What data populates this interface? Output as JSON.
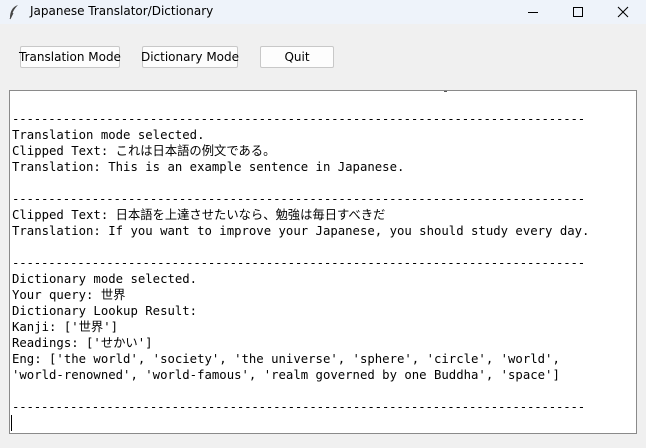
{
  "window": {
    "title": "Japanese Translator/Dictionary",
    "controls": [
      "minimize",
      "maximize",
      "close"
    ]
  },
  "toolbar": {
    "translation_label": "Translation Mode",
    "dictionary_label": "Dictionary Mode",
    "quit_label": "Quit"
  },
  "output": {
    "lines": [
      "-------------------------------------------------------------------------------",
      "Translation mode selected.",
      "Clipped Text: これは日本語の例文である。",
      "Translation: This is an example sentence in Japanese.",
      "",
      "-------------------------------------------------------------------------------",
      "Clipped Text: 日本語を上達させたいなら、勉強は毎日すべきだ",
      "Translation: If you want to improve your Japanese, you should study every day.",
      "",
      "-------------------------------------------------------------------------------",
      "Dictionary mode selected.",
      "Your query: 世界",
      "Dictionary Lookup Result:",
      "Kanji: ['世界']",
      "Readings: ['せかい']",
      "Eng: ['the world', 'society', 'the universe', 'sphere', 'circle', 'world',",
      "'world-renowned', 'world-famous', 'realm governed by one Buddha', 'space']",
      "",
      "-------------------------------------------------------------------------------"
    ]
  }
}
